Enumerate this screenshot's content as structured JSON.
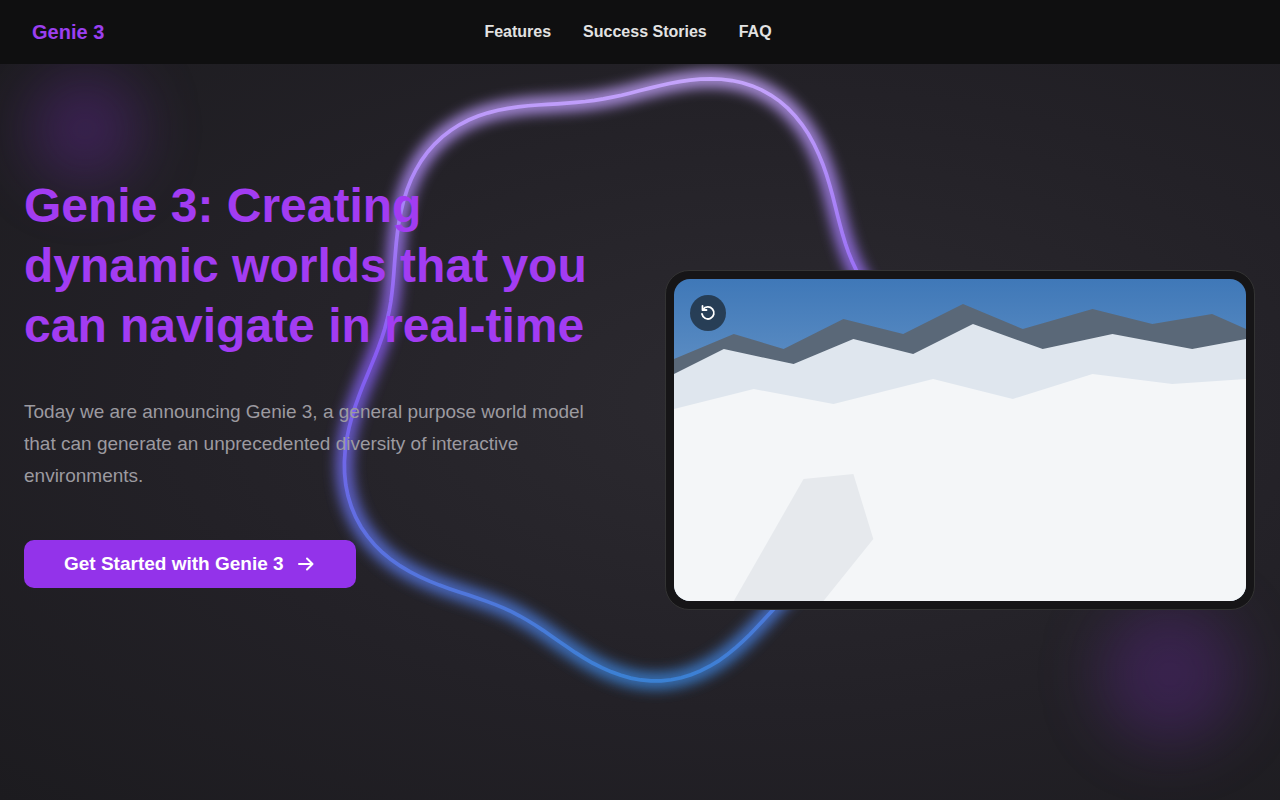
{
  "logo": "Genie 3",
  "nav": [
    "Features",
    "Success Stories",
    "FAQ"
  ],
  "hero": {
    "title": "Genie 3: Creating dynamic worlds that you can navigate in real-time",
    "description": "Today we are announcing Genie 3, a general purpose world model that can generate an unprecedented diversity of interactive environments.",
    "cta": "Get Started with Genie 3"
  }
}
